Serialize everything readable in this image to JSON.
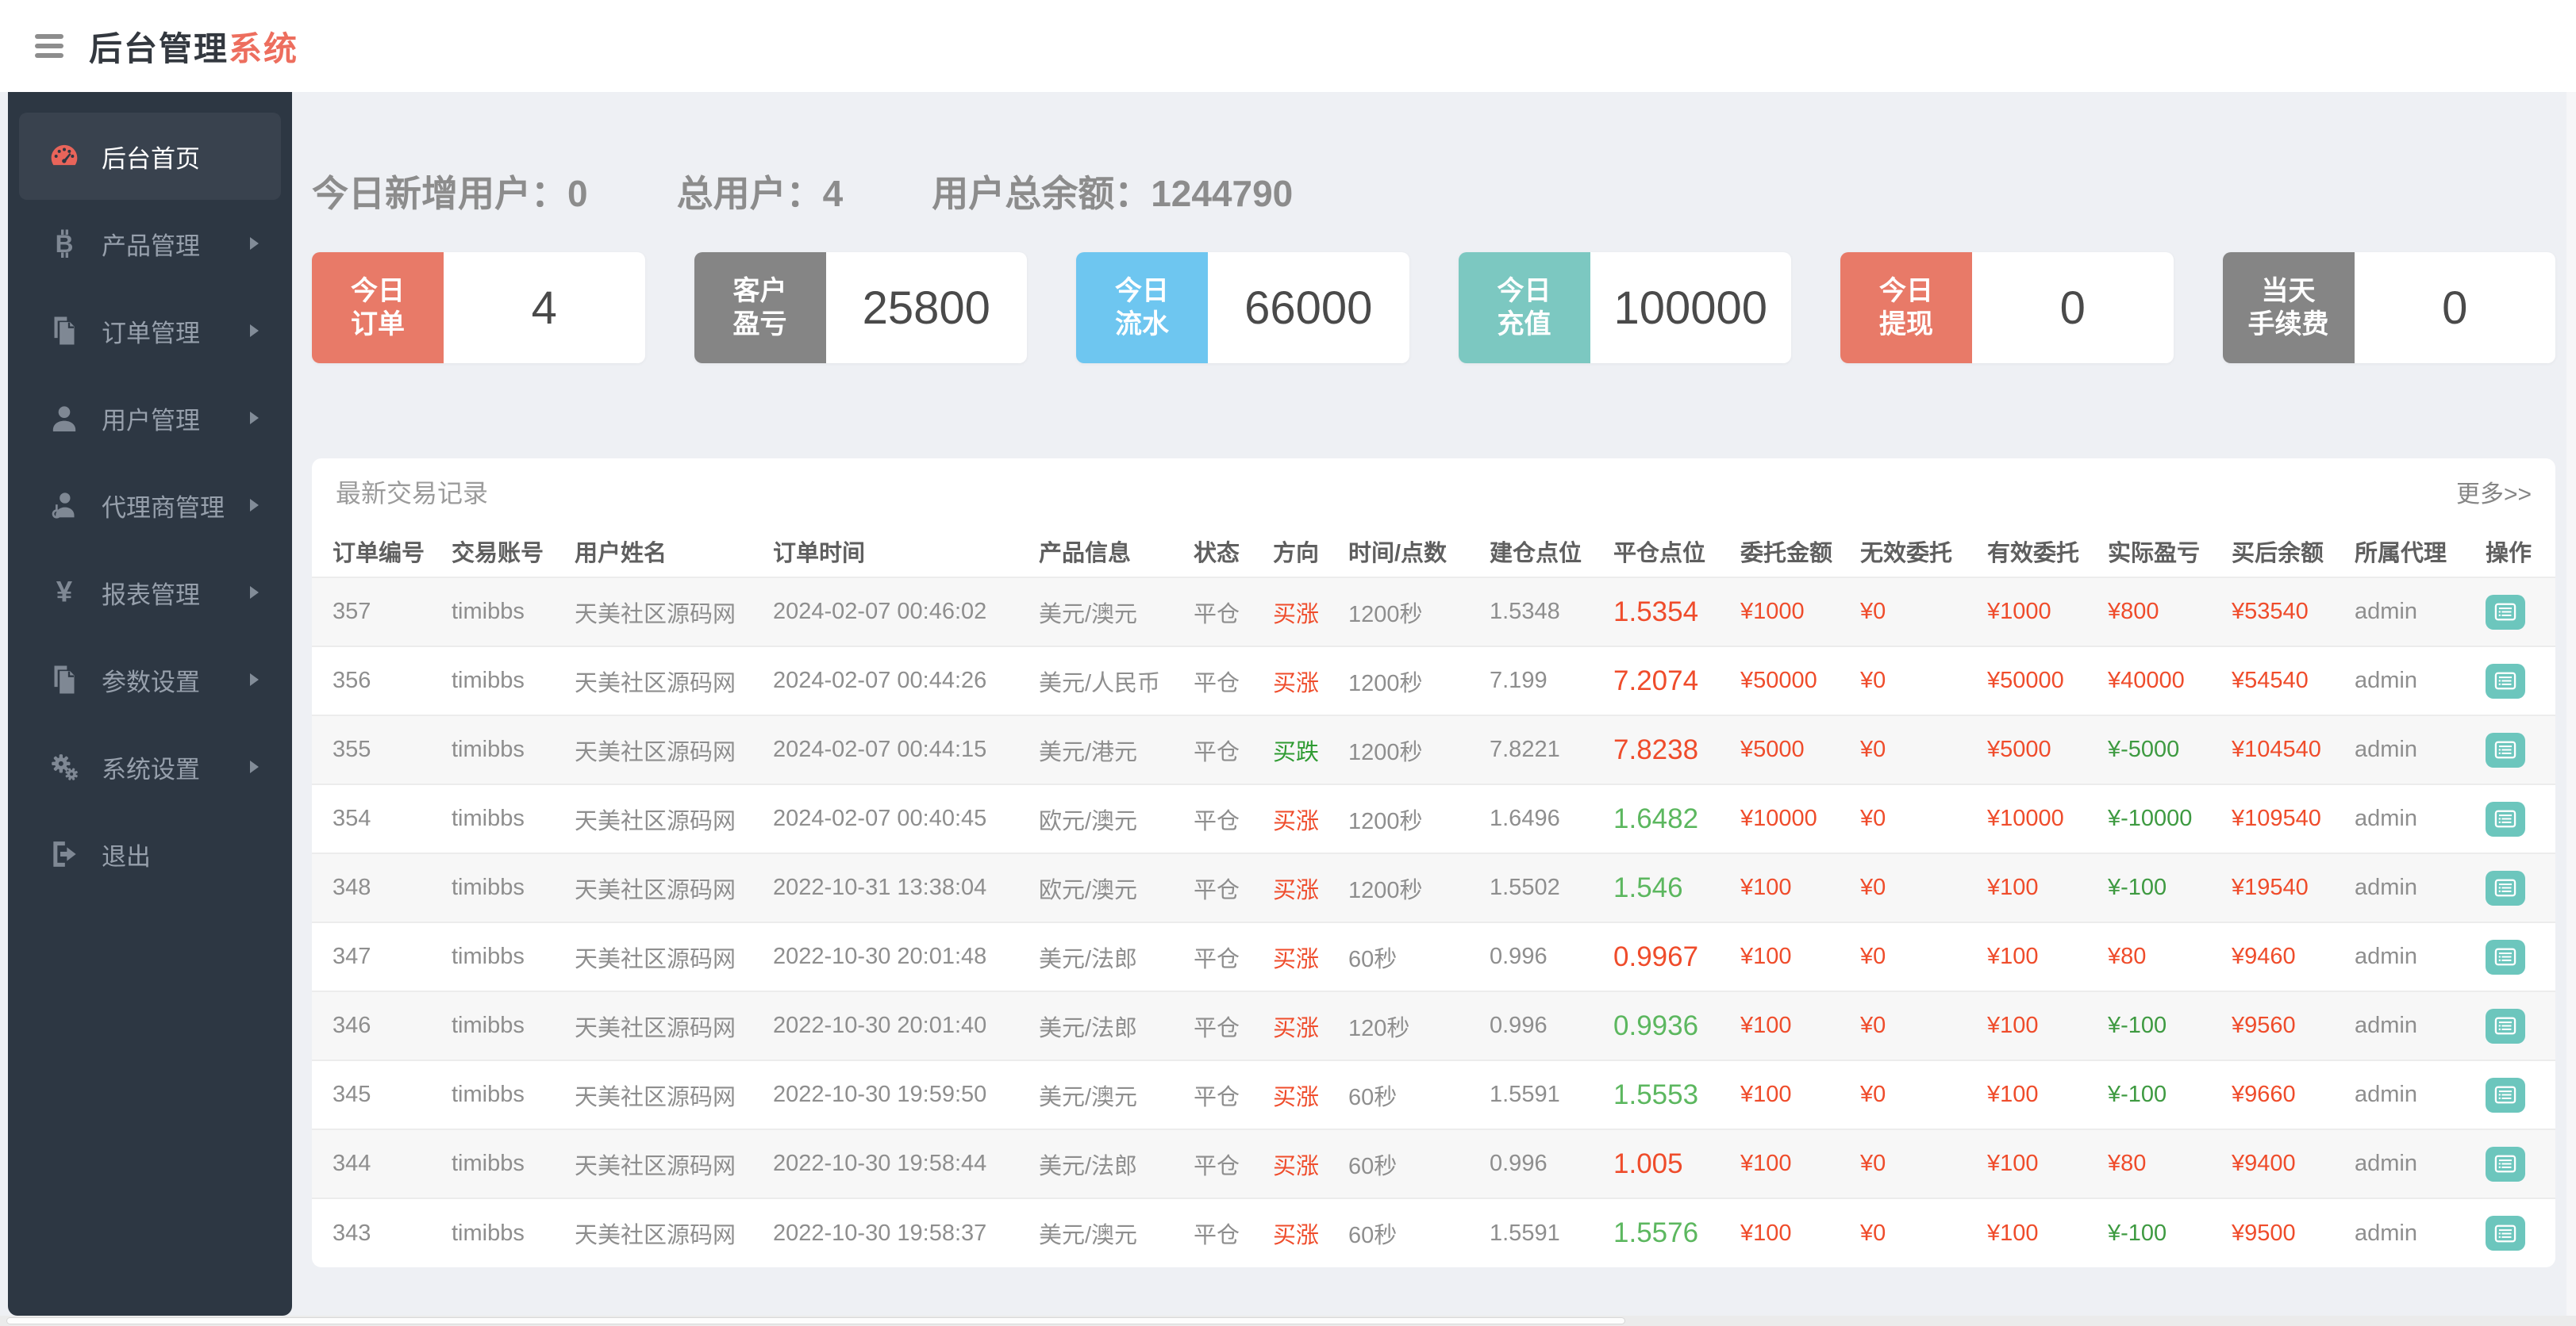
{
  "theme": {
    "accent_red": "#ed6e5e",
    "sidebar_bg": "#2d3743",
    "gauge_red": "#e8645a",
    "money_red": "#ef4c2b",
    "dir_green": "#2f9b32",
    "close_green": "#5cb75f",
    "profit_green": "#3e9a41",
    "action_teal": "#6cc6bd",
    "card_red": "#e87a68",
    "card_gray": "#858585",
    "card_blue": "#6ec6f0",
    "card_teal": "#7cc8c1"
  },
  "header": {
    "title_main": "后台管理",
    "title_accent": "系统"
  },
  "sidebar": {
    "items": [
      {
        "label": "后台首页",
        "icon": "dashboard-icon",
        "active": true,
        "has_arrow": false
      },
      {
        "label": "产品管理",
        "icon": "bitcoin-icon",
        "active": false,
        "has_arrow": true
      },
      {
        "label": "订单管理",
        "icon": "copy-icon",
        "active": false,
        "has_arrow": true
      },
      {
        "label": "用户管理",
        "icon": "user-icon",
        "active": false,
        "has_arrow": true
      },
      {
        "label": "代理商管理",
        "icon": "agent-icon",
        "active": false,
        "has_arrow": true
      },
      {
        "label": "报表管理",
        "icon": "yen-icon",
        "active": false,
        "has_arrow": true
      },
      {
        "label": "参数设置",
        "icon": "copy-icon",
        "active": false,
        "has_arrow": true
      },
      {
        "label": "系统设置",
        "icon": "gears-icon",
        "active": false,
        "has_arrow": true
      },
      {
        "label": "退出",
        "icon": "logout-icon",
        "active": false,
        "has_arrow": false
      }
    ]
  },
  "stats": [
    {
      "label": "今日新增用户：",
      "value": "0"
    },
    {
      "label": "总用户：",
      "value": "4"
    },
    {
      "label": "用户总余额：",
      "value": "1244790"
    }
  ],
  "summary_cards": [
    {
      "lines": [
        "今日",
        "订单"
      ],
      "value": "4",
      "color_key": "card_red"
    },
    {
      "lines": [
        "客户",
        "盈亏"
      ],
      "value": "25800",
      "color_key": "card_gray"
    },
    {
      "lines": [
        "今日",
        "流水"
      ],
      "value": "66000",
      "color_key": "card_blue"
    },
    {
      "lines": [
        "今日",
        "充值"
      ],
      "value": "100000",
      "color_key": "card_teal"
    },
    {
      "lines": [
        "今日",
        "提现"
      ],
      "value": "0",
      "color_key": "card_red"
    },
    {
      "lines": [
        "当天",
        "手续费"
      ],
      "value": "0",
      "color_key": "card_gray"
    }
  ],
  "panel": {
    "title": "最新交易记录",
    "more_link": "更多>>",
    "columns": [
      "订单编号",
      "交易账号",
      "用户姓名",
      "订单时间",
      "产品信息",
      "状态",
      "方向",
      "时间/点数",
      "建仓点位",
      "平仓点位",
      "委托金额",
      "无效委托",
      "有效委托",
      "实际盈亏",
      "买后余额",
      "所属代理",
      "操作"
    ],
    "rows": [
      {
        "id": "357",
        "account": "timibbs",
        "name": "天美社区源码网",
        "time": "2024-02-07 00:46:02",
        "product": "美元/澳元",
        "status": "平仓",
        "direction": "买涨",
        "direction_trend": "up",
        "duration": "1200秒",
        "open": "1.5348",
        "close": "1.5354",
        "close_trend": "up",
        "amount": "¥1000",
        "invalid": "¥0",
        "valid": "¥1000",
        "profit": "¥800",
        "profit_trend": "up",
        "balance": "¥53540",
        "agent": "admin"
      },
      {
        "id": "356",
        "account": "timibbs",
        "name": "天美社区源码网",
        "time": "2024-02-07 00:44:26",
        "product": "美元/人民币",
        "status": "平仓",
        "direction": "买涨",
        "direction_trend": "up",
        "duration": "1200秒",
        "open": "7.199",
        "close": "7.2074",
        "close_trend": "up",
        "amount": "¥50000",
        "invalid": "¥0",
        "valid": "¥50000",
        "profit": "¥40000",
        "profit_trend": "up",
        "balance": "¥54540",
        "agent": "admin"
      },
      {
        "id": "355",
        "account": "timibbs",
        "name": "天美社区源码网",
        "time": "2024-02-07 00:44:15",
        "product": "美元/港元",
        "status": "平仓",
        "direction": "买跌",
        "direction_trend": "down",
        "duration": "1200秒",
        "open": "7.8221",
        "close": "7.8238",
        "close_trend": "up",
        "amount": "¥5000",
        "invalid": "¥0",
        "valid": "¥5000",
        "profit": "¥-5000",
        "profit_trend": "down",
        "balance": "¥104540",
        "agent": "admin"
      },
      {
        "id": "354",
        "account": "timibbs",
        "name": "天美社区源码网",
        "time": "2024-02-07 00:40:45",
        "product": "欧元/澳元",
        "status": "平仓",
        "direction": "买涨",
        "direction_trend": "up",
        "duration": "1200秒",
        "open": "1.6496",
        "close": "1.6482",
        "close_trend": "down",
        "amount": "¥10000",
        "invalid": "¥0",
        "valid": "¥10000",
        "profit": "¥-10000",
        "profit_trend": "down",
        "balance": "¥109540",
        "agent": "admin"
      },
      {
        "id": "348",
        "account": "timibbs",
        "name": "天美社区源码网",
        "time": "2022-10-31 13:38:04",
        "product": "欧元/澳元",
        "status": "平仓",
        "direction": "买涨",
        "direction_trend": "up",
        "duration": "1200秒",
        "open": "1.5502",
        "close": "1.546",
        "close_trend": "down",
        "amount": "¥100",
        "invalid": "¥0",
        "valid": "¥100",
        "profit": "¥-100",
        "profit_trend": "down",
        "balance": "¥19540",
        "agent": "admin"
      },
      {
        "id": "347",
        "account": "timibbs",
        "name": "天美社区源码网",
        "time": "2022-10-30 20:01:48",
        "product": "美元/法郎",
        "status": "平仓",
        "direction": "买涨",
        "direction_trend": "up",
        "duration": "60秒",
        "open": "0.996",
        "close": "0.9967",
        "close_trend": "up",
        "amount": "¥100",
        "invalid": "¥0",
        "valid": "¥100",
        "profit": "¥80",
        "profit_trend": "up",
        "balance": "¥9460",
        "agent": "admin"
      },
      {
        "id": "346",
        "account": "timibbs",
        "name": "天美社区源码网",
        "time": "2022-10-30 20:01:40",
        "product": "美元/法郎",
        "status": "平仓",
        "direction": "买涨",
        "direction_trend": "up",
        "duration": "120秒",
        "open": "0.996",
        "close": "0.9936",
        "close_trend": "down",
        "amount": "¥100",
        "invalid": "¥0",
        "valid": "¥100",
        "profit": "¥-100",
        "profit_trend": "down",
        "balance": "¥9560",
        "agent": "admin"
      },
      {
        "id": "345",
        "account": "timibbs",
        "name": "天美社区源码网",
        "time": "2022-10-30 19:59:50",
        "product": "美元/澳元",
        "status": "平仓",
        "direction": "买涨",
        "direction_trend": "up",
        "duration": "60秒",
        "open": "1.5591",
        "close": "1.5553",
        "close_trend": "down",
        "amount": "¥100",
        "invalid": "¥0",
        "valid": "¥100",
        "profit": "¥-100",
        "profit_trend": "down",
        "balance": "¥9660",
        "agent": "admin"
      },
      {
        "id": "344",
        "account": "timibbs",
        "name": "天美社区源码网",
        "time": "2022-10-30 19:58:44",
        "product": "美元/法郎",
        "status": "平仓",
        "direction": "买涨",
        "direction_trend": "up",
        "duration": "60秒",
        "open": "0.996",
        "close": "1.005",
        "close_trend": "up",
        "amount": "¥100",
        "invalid": "¥0",
        "valid": "¥100",
        "profit": "¥80",
        "profit_trend": "up",
        "balance": "¥9400",
        "agent": "admin"
      },
      {
        "id": "343",
        "account": "timibbs",
        "name": "天美社区源码网",
        "time": "2022-10-30 19:58:37",
        "product": "美元/澳元",
        "status": "平仓",
        "direction": "买涨",
        "direction_trend": "up",
        "duration": "60秒",
        "open": "1.5591",
        "close": "1.5576",
        "close_trend": "down",
        "amount": "¥100",
        "invalid": "¥0",
        "valid": "¥100",
        "profit": "¥-100",
        "profit_trend": "down",
        "balance": "¥9500",
        "agent": "admin"
      }
    ]
  }
}
